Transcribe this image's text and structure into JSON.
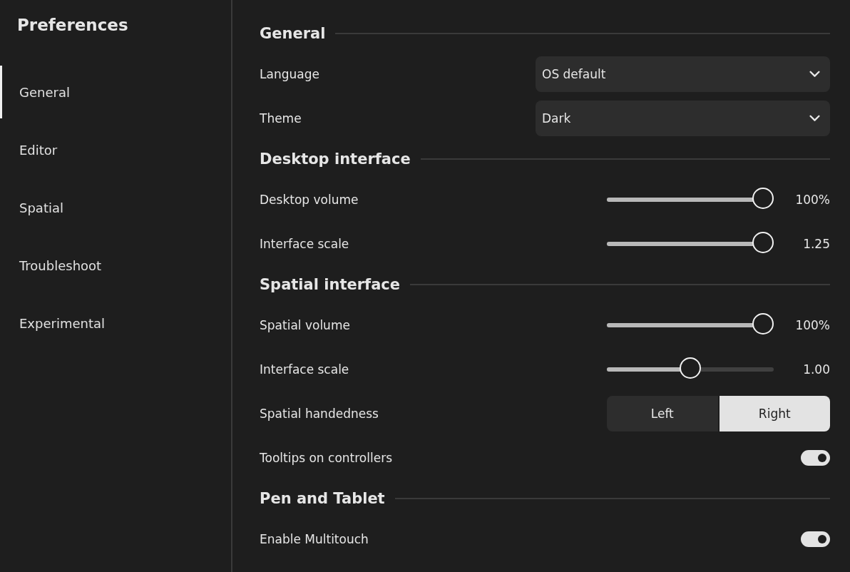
{
  "sidebar": {
    "title": "Preferences",
    "items": [
      {
        "label": "General",
        "selected": true
      },
      {
        "label": "Editor",
        "selected": false
      },
      {
        "label": "Spatial",
        "selected": false
      },
      {
        "label": "Troubleshoot",
        "selected": false
      },
      {
        "label": "Experimental",
        "selected": false
      }
    ]
  },
  "sections": [
    {
      "title": "General",
      "rows": [
        {
          "kind": "dropdown",
          "label": "Language",
          "value": "OS default"
        },
        {
          "kind": "dropdown",
          "label": "Theme",
          "value": "Dark"
        }
      ]
    },
    {
      "title": "Desktop interface",
      "rows": [
        {
          "kind": "slider",
          "label": "Desktop volume",
          "level": 1,
          "reading": "100%"
        },
        {
          "kind": "slider",
          "label": "Interface scale",
          "level": 1,
          "reading": "1.25"
        }
      ]
    },
    {
      "title": "Spatial interface",
      "rows": [
        {
          "kind": "slider",
          "label": "Spatial volume",
          "level": 1,
          "reading": "100%"
        },
        {
          "kind": "slider",
          "label": "Interface scale",
          "level": 0.5,
          "reading": "1.00"
        },
        {
          "kind": "segmented",
          "label": "Spatial handedness",
          "options": [
            {
              "label": "Left",
              "selected": false
            },
            {
              "label": "Right",
              "selected": true
            }
          ]
        },
        {
          "kind": "toggle",
          "label": "Tooltips on controllers",
          "on": true
        }
      ]
    },
    {
      "title": "Pen and Tablet",
      "rows": [
        {
          "kind": "toggle",
          "label": "Enable Multitouch",
          "on": true
        }
      ]
    }
  ]
}
